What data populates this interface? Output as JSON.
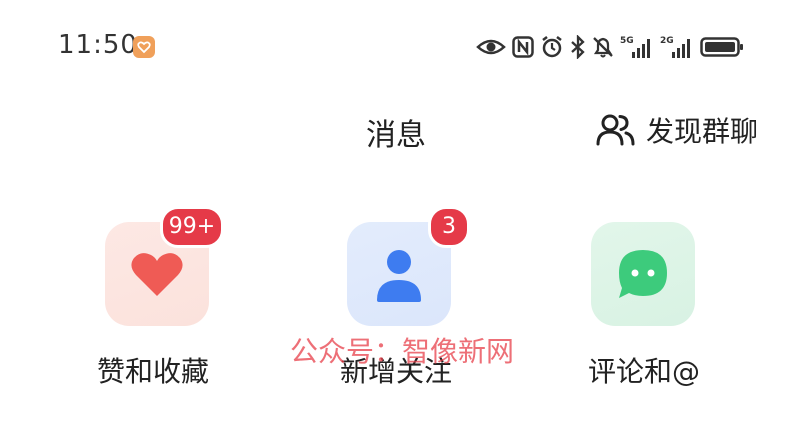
{
  "status_bar": {
    "time": "11:50",
    "network_1": "5G",
    "network_2": "2G"
  },
  "header": {
    "title": "消息",
    "discover_group_label": "发现群聊"
  },
  "entries": [
    {
      "label": "赞和收藏",
      "badge": "99+",
      "icon": "heart-icon",
      "color": "#ef5b55"
    },
    {
      "label": "新增关注",
      "badge": "3",
      "icon": "person-icon",
      "color": "#3e7cf0"
    },
    {
      "label": "评论和@",
      "badge": "",
      "icon": "chat-bubble-icon",
      "color": "#3dcb7c"
    }
  ],
  "watermark": "公众号：智像新网",
  "colors": {
    "badge": "#e53a48",
    "accent_app": "#f0a05a"
  }
}
